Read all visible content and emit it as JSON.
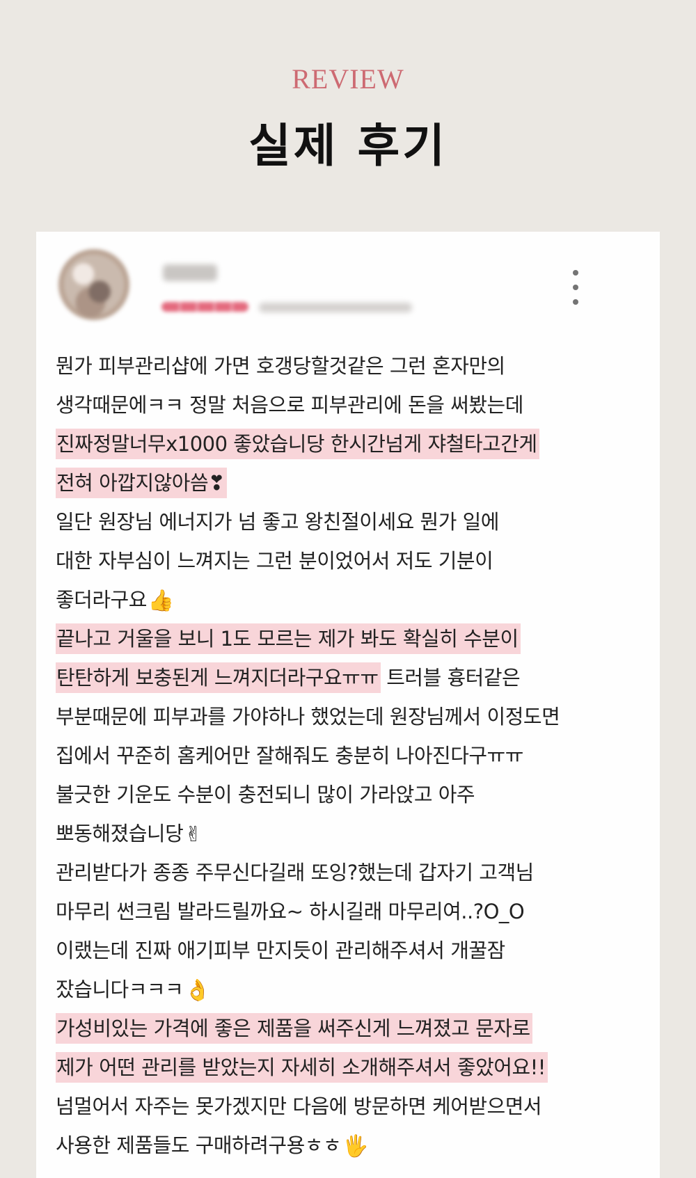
{
  "header": {
    "eyebrow": "REVIEW",
    "title": "실제 후기"
  },
  "review": {
    "more_icon": "more-vertical-icon",
    "lines": [
      {
        "plain": "뭔가 피부관리샵에 가면 호갱당할것같은 그런 혼자만의",
        "highlight": "",
        "tail": "",
        "emoji": ""
      },
      {
        "plain": "생각때문에ㅋㅋ 정말 처음으로 피부관리에 돈을 써봤는데",
        "highlight": "",
        "tail": "",
        "emoji": ""
      },
      {
        "plain": "",
        "highlight": "진짜정말너무x1000 좋았습니당 한시간넘게 쟈철타고간게",
        "tail": "",
        "emoji": ""
      },
      {
        "plain": "",
        "highlight": "전혀 아깝지않아씀❣",
        "tail": "",
        "emoji": ""
      },
      {
        "plain": "일단 원장님 에너지가 넘 좋고 왕친절이세요 뭔가 일에",
        "highlight": "",
        "tail": "",
        "emoji": ""
      },
      {
        "plain": "대한 자부심이 느껴지는 그런 분이었어서 저도 기분이",
        "highlight": "",
        "tail": "",
        "emoji": ""
      },
      {
        "plain": "좋더라구요",
        "highlight": "",
        "tail": "",
        "emoji": "👍"
      },
      {
        "plain": "",
        "highlight": "끝나고 거울을 보니 1도 모르는 제가 봐도 확실히 수분이",
        "tail": "",
        "emoji": ""
      },
      {
        "plain": "",
        "highlight": "탄탄하게 보충된게 느껴지더라구요ㅠㅠ",
        "tail": " 트러블 흉터같은",
        "emoji": ""
      },
      {
        "plain": "부분때문에 피부과를 가야하나 했었는데 원장님께서 이정도면",
        "highlight": "",
        "tail": "",
        "emoji": ""
      },
      {
        "plain": "집에서 꾸준히 홈케어만 잘해줘도 충분히 나아진다구ㅠㅠ",
        "highlight": "",
        "tail": "",
        "emoji": ""
      },
      {
        "plain": "불긋한 기운도 수분이 충전되니 많이 가라앉고 아주",
        "highlight": "",
        "tail": "",
        "emoji": ""
      },
      {
        "plain": "뽀동해졌습니당",
        "highlight": "",
        "tail": "",
        "emoji": "✌"
      },
      {
        "plain": "관리받다가 종종 주무신다길래 또잉?했는데 갑자기 고객님",
        "highlight": "",
        "tail": "",
        "emoji": ""
      },
      {
        "plain": "마무리 썬크림 발라드릴까요~ 하시길래 마무리여..?O_O",
        "highlight": "",
        "tail": "",
        "emoji": ""
      },
      {
        "plain": "이랬는데 진짜 애기피부 만지듯이 관리해주셔서 개꿀잠",
        "highlight": "",
        "tail": "",
        "emoji": ""
      },
      {
        "plain": "잤습니다ㅋㅋㅋ",
        "highlight": "",
        "tail": "",
        "emoji": "👌"
      },
      {
        "plain": "",
        "highlight": "가성비있는 가격에 좋은 제품을 써주신게 느껴졌고 문자로",
        "tail": "",
        "emoji": ""
      },
      {
        "plain": "",
        "highlight": "제가 어떤 관리를 받았는지 자세히 소개해주셔서 좋았어요!!",
        "tail": "",
        "emoji": ""
      },
      {
        "plain": "넘멀어서 자주는 못가겠지만 다음에 방문하면 케어받으면서",
        "highlight": "",
        "tail": "",
        "emoji": ""
      },
      {
        "plain": "사용한 제품들도 구매하려구용ㅎㅎ",
        "highlight": "",
        "tail": "",
        "emoji": "🖐"
      }
    ]
  }
}
